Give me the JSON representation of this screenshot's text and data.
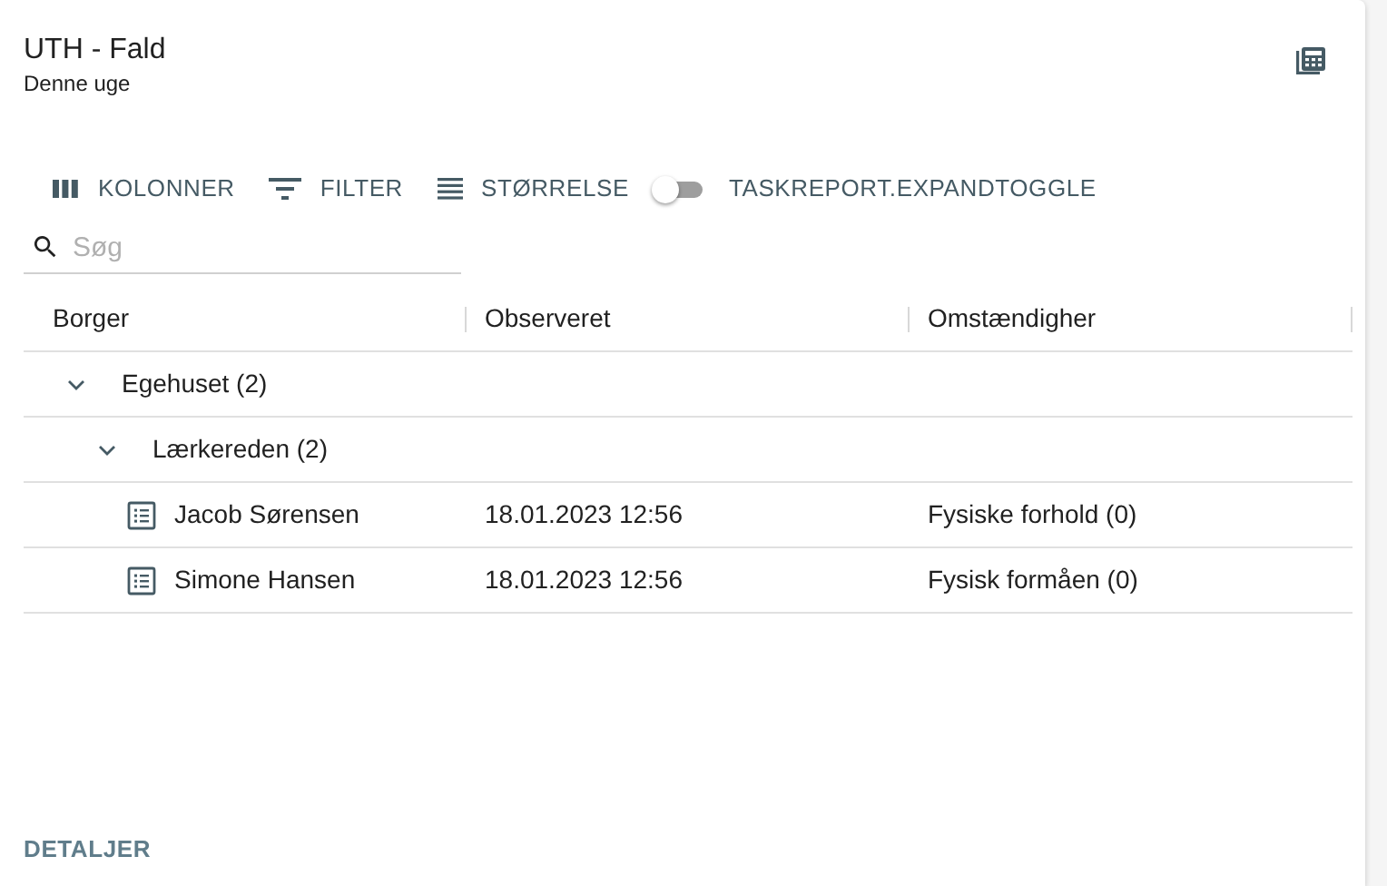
{
  "card": {
    "title": "UTH - Fald",
    "subtitle": "Denne uge"
  },
  "toolbar": {
    "buttons": [
      {
        "kind": "columns",
        "label": "KOLONNER"
      },
      {
        "kind": "filter",
        "label": "FILTER"
      },
      {
        "kind": "density",
        "label": "STØRRELSE"
      }
    ],
    "toggle": {
      "label": "TASKREPORT.EXPANDTOGGLE",
      "on": false
    }
  },
  "search": {
    "placeholder": "Søg"
  },
  "table": {
    "columns": [
      "Borger",
      "Observeret",
      "Omstændigher"
    ],
    "rows": [
      {
        "kind": "group",
        "label": "Egehuset (2)",
        "expanded": true,
        "children": [
          {
            "kind": "group",
            "label": "Lærkereden (2)",
            "expanded": true,
            "children": [
              {
                "kind": "record",
                "cells": [
                  "Jacob Sørensen",
                  "18.01.2023 12:56",
                  "Fysiske forhold (0)"
                ]
              },
              {
                "kind": "record",
                "cells": [
                  "Simone Hansen",
                  "18.01.2023 12:56",
                  "Fysisk formåen (0)"
                ]
              }
            ]
          }
        ]
      }
    ]
  },
  "footer": {
    "label": "DETALJER"
  }
}
